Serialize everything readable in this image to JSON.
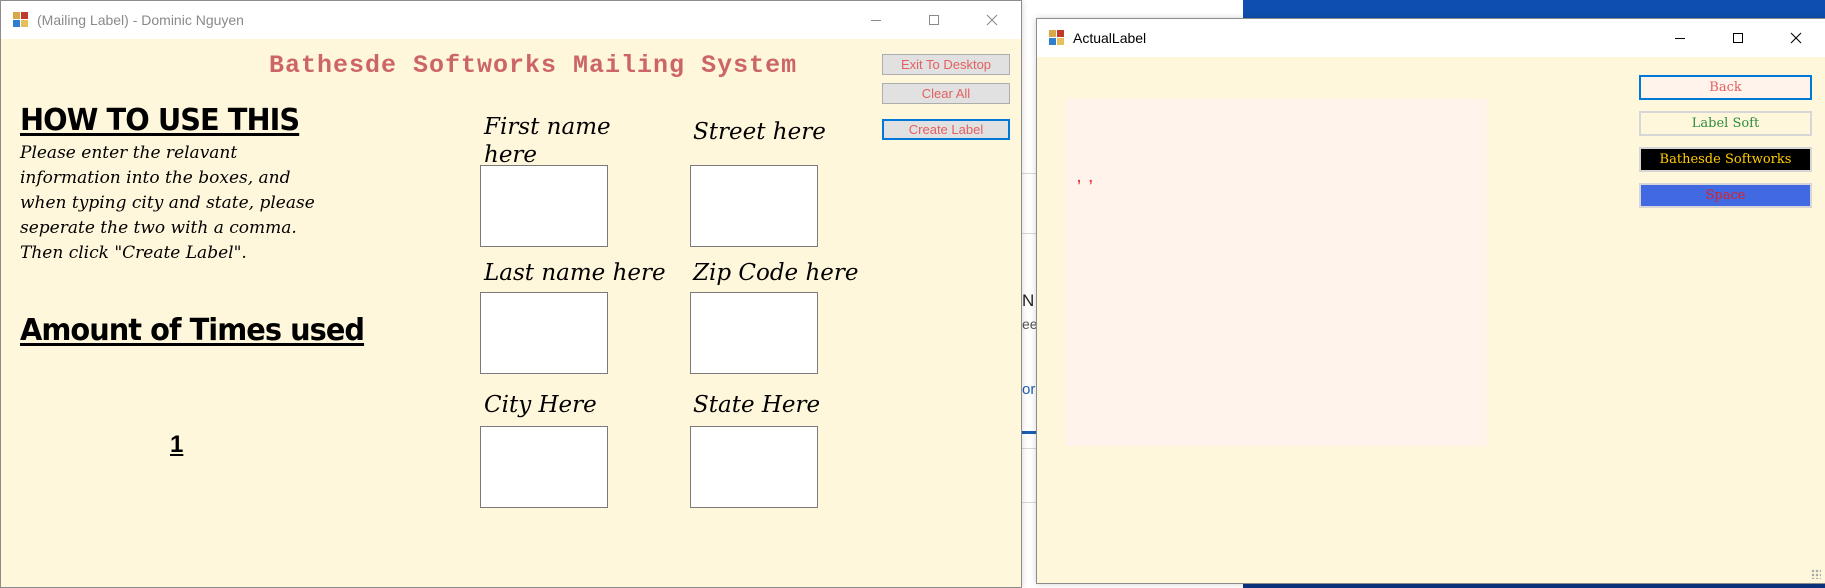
{
  "background": {
    "partial_text": [
      "N",
      "ee",
      "or"
    ]
  },
  "main_window": {
    "title": "(Mailing Label) - Dominic Nguyen",
    "heading": "Bathesde Softworks Mailing System",
    "buttons": {
      "exit": "Exit To Desktop",
      "clear": "Clear All",
      "create": "Create Label"
    },
    "howto_title": "HOW TO USE THIS",
    "howto_lines": [
      "Please enter the relavant",
      "information into the boxes, and",
      "when typing city and state, please",
      "seperate the two with a comma.",
      "Then click \"Create Label\"."
    ],
    "amount_title": "Amount of Times used",
    "times_used": "1",
    "fields": {
      "first_name_line1": "First name",
      "first_name_line2": "here",
      "street": "Street here",
      "last_name": "Last name here",
      "zip": "Zip Code here",
      "city": "City Here",
      "state": "State Here"
    }
  },
  "label_window": {
    "title": "ActualLabel",
    "panel_text": ", ,",
    "buttons": {
      "back": "Back",
      "label_soft": "Label Soft",
      "bathesde": "Bathesde Softworks",
      "space": "Space"
    }
  },
  "colors": {
    "window_bg": "#fff7dc",
    "heading": "#cc6666",
    "focus_border": "#0078d7",
    "space_button": "#4169e1"
  },
  "icons": [
    "app-icon",
    "minimize-icon",
    "maximize-icon",
    "close-icon"
  ]
}
